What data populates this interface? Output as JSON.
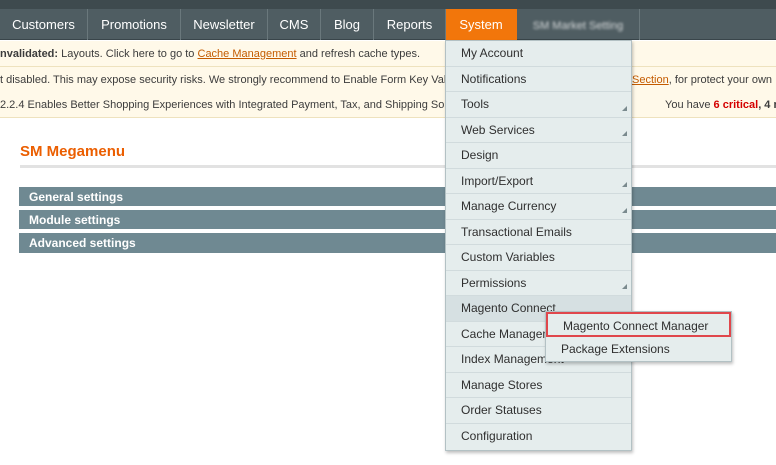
{
  "nav": {
    "items": [
      {
        "label": "Customers"
      },
      {
        "label": "Promotions"
      },
      {
        "label": "Newsletter"
      },
      {
        "label": "CMS"
      },
      {
        "label": "Blog"
      },
      {
        "label": "Reports"
      },
      {
        "label": "System"
      },
      {
        "label": "SM Market Setting"
      }
    ],
    "active": "System"
  },
  "notices": {
    "n1": {
      "bold": "nvalidated:",
      "text_before": " Layouts. Click here to go to ",
      "link": "Cache Management",
      "text_after": " and refresh cache types."
    },
    "n2": {
      "text": "t disabled. This may expose security risks. We strongly recommend to Enable Form Key Vali",
      "right_link": "Section",
      "right_text": ", for protect your own"
    },
    "n3": {
      "text": "2.2.4 Enables Better Shopping Experiences with Integrated Payment, Tax, and Shipping Soluti",
      "right_prefix": "You have ",
      "critical_count": "6",
      "critical_label": "critical",
      "right_suffix": ", 4 m"
    }
  },
  "page": {
    "title": "SM Megamenu",
    "sections": [
      "General settings",
      "Module settings",
      "Advanced settings"
    ]
  },
  "dropdown": {
    "items": [
      {
        "label": "My Account"
      },
      {
        "label": "Notifications"
      },
      {
        "label": "Tools"
      },
      {
        "label": "Web Services"
      },
      {
        "label": "Design"
      },
      {
        "label": "Import/Export"
      },
      {
        "label": "Manage Currency"
      },
      {
        "label": "Transactional Emails"
      },
      {
        "label": "Custom Variables"
      },
      {
        "label": "Permissions"
      },
      {
        "label": "Magento Connect"
      },
      {
        "label": "Cache Management"
      },
      {
        "label": "Index Management"
      },
      {
        "label": "Manage Stores"
      },
      {
        "label": "Order Statuses"
      },
      {
        "label": "Configuration"
      }
    ]
  },
  "submenu": {
    "items": [
      {
        "label": "Magento Connect Manager"
      },
      {
        "label": "Package Extensions"
      }
    ]
  },
  "colors": {
    "nav_bg": "#4f5d62",
    "active_tab": "#f2760b",
    "title": "#eb5e00",
    "section_bg": "#6f8992",
    "highlight_border": "#e0474c"
  }
}
